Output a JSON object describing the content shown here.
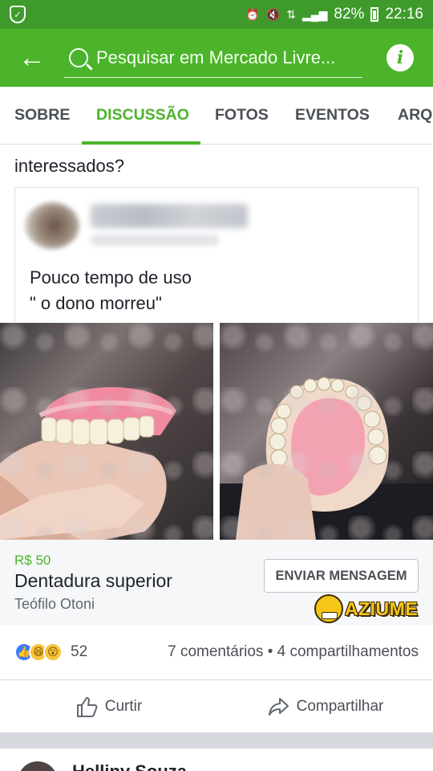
{
  "status_bar": {
    "battery": "82%",
    "time": "22:16",
    "icons": [
      "shield-icon",
      "alarm-icon",
      "mute-icon",
      "data-icon",
      "signal-icon",
      "battery-icon"
    ]
  },
  "app_bar": {
    "back_icon": "arrow-left-icon",
    "search_placeholder": "Pesquisar em Mercado Livre...",
    "info_icon": "info-icon"
  },
  "tabs": [
    {
      "label": "SOBRE",
      "active": false
    },
    {
      "label": "DISCUSSÃO",
      "active": true
    },
    {
      "label": "FOTOS",
      "active": false
    },
    {
      "label": "EVENTOS",
      "active": false
    },
    {
      "label": "ARQ",
      "active": false
    }
  ],
  "post": {
    "previous_text": "interessados?",
    "shared_text_line1": "Pouco tempo de uso",
    "shared_text_line2": "\" o dono morreu\""
  },
  "listing": {
    "price": "R$ 50",
    "title": "Dentadura superior",
    "city": "Teófilo Otoni",
    "message_button": "ENVIAR MENSAGEM"
  },
  "watermark": {
    "text": "AZIUME"
  },
  "reactions": {
    "count": "52",
    "stats": "7 comentários • 4 compartilhamentos",
    "types": [
      "like",
      "haha",
      "wow"
    ]
  },
  "actions": {
    "like": "Curtir",
    "share": "Compartilhar"
  },
  "next_post": {
    "author": "Helliny Souza"
  },
  "colors": {
    "status_green": "#3e9b2b",
    "brand_green": "#4bb42a",
    "text": "#1d2129",
    "muted": "#4b4f56"
  }
}
